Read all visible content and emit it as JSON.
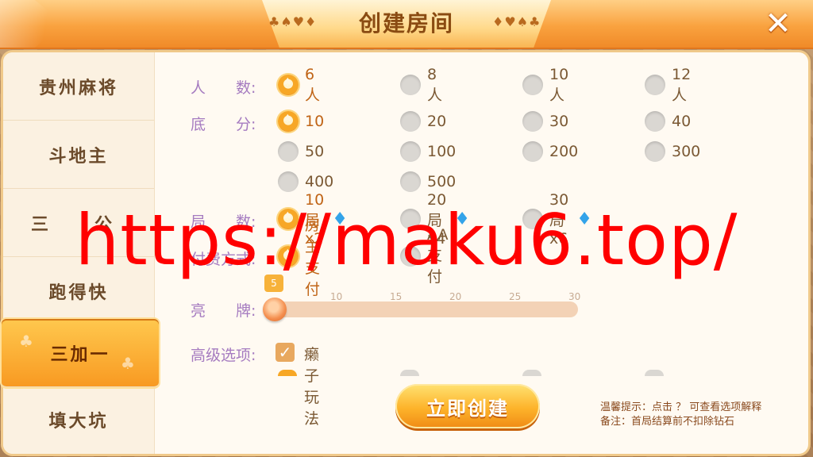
{
  "header": {
    "title": "创建房间",
    "deco_left": "♣♠♥♦",
    "deco_right": "♦♥♠♣",
    "close_glyph": "✕"
  },
  "sidebar": {
    "items": [
      {
        "label": "贵州麻将"
      },
      {
        "label": "斗地主"
      },
      {
        "label": "三　公"
      },
      {
        "label": "跑得快"
      },
      {
        "label": "三加一"
      },
      {
        "label": "填大坑"
      }
    ],
    "active_index": 4
  },
  "options": {
    "players": {
      "label": "人　　数:",
      "choices": [
        "6人",
        "8人",
        "10人",
        "12人"
      ],
      "selected": "6人"
    },
    "base_score": {
      "label": "底　　分:",
      "choices": [
        "10",
        "20",
        "30",
        "40",
        "50",
        "100",
        "200",
        "300",
        "400",
        "500"
      ],
      "selected": "10"
    },
    "rounds": {
      "label": "局　　数:",
      "choices": [
        "10局x2",
        "20局x4",
        "30局x6"
      ],
      "selected": "10局x2"
    },
    "payment": {
      "label": "付费方式:",
      "choices": [
        "房主支付",
        "AA支付"
      ],
      "selected": "房主支付"
    },
    "show_cards": {
      "label": "亮　　牌:",
      "value": 5,
      "ticks": [
        "10",
        "15",
        "20",
        "25",
        "30"
      ]
    },
    "advanced": {
      "label": "高级选项:",
      "checkbox_label": "癞子玩法",
      "checked": true,
      "check_glyph": "✓"
    }
  },
  "create_button": {
    "label": "立即创建"
  },
  "tips": {
    "line1": "温馨提示：点击 ？ 可查看选项解释",
    "line2": "备注：首局结算前不扣除钻石"
  },
  "watermark": {
    "text": "https://maku6.top/"
  },
  "icons": {
    "diamond": "diamond-icon",
    "close": "close-icon",
    "radio_selected": "spade-radio-icon"
  },
  "colors": {
    "header_orange": "#f9a23f",
    "active_tab": "#f89a22",
    "label_purple": "#a57bc0",
    "watermark_red": "#ff0000",
    "diamond_blue": "#33a3e9"
  }
}
